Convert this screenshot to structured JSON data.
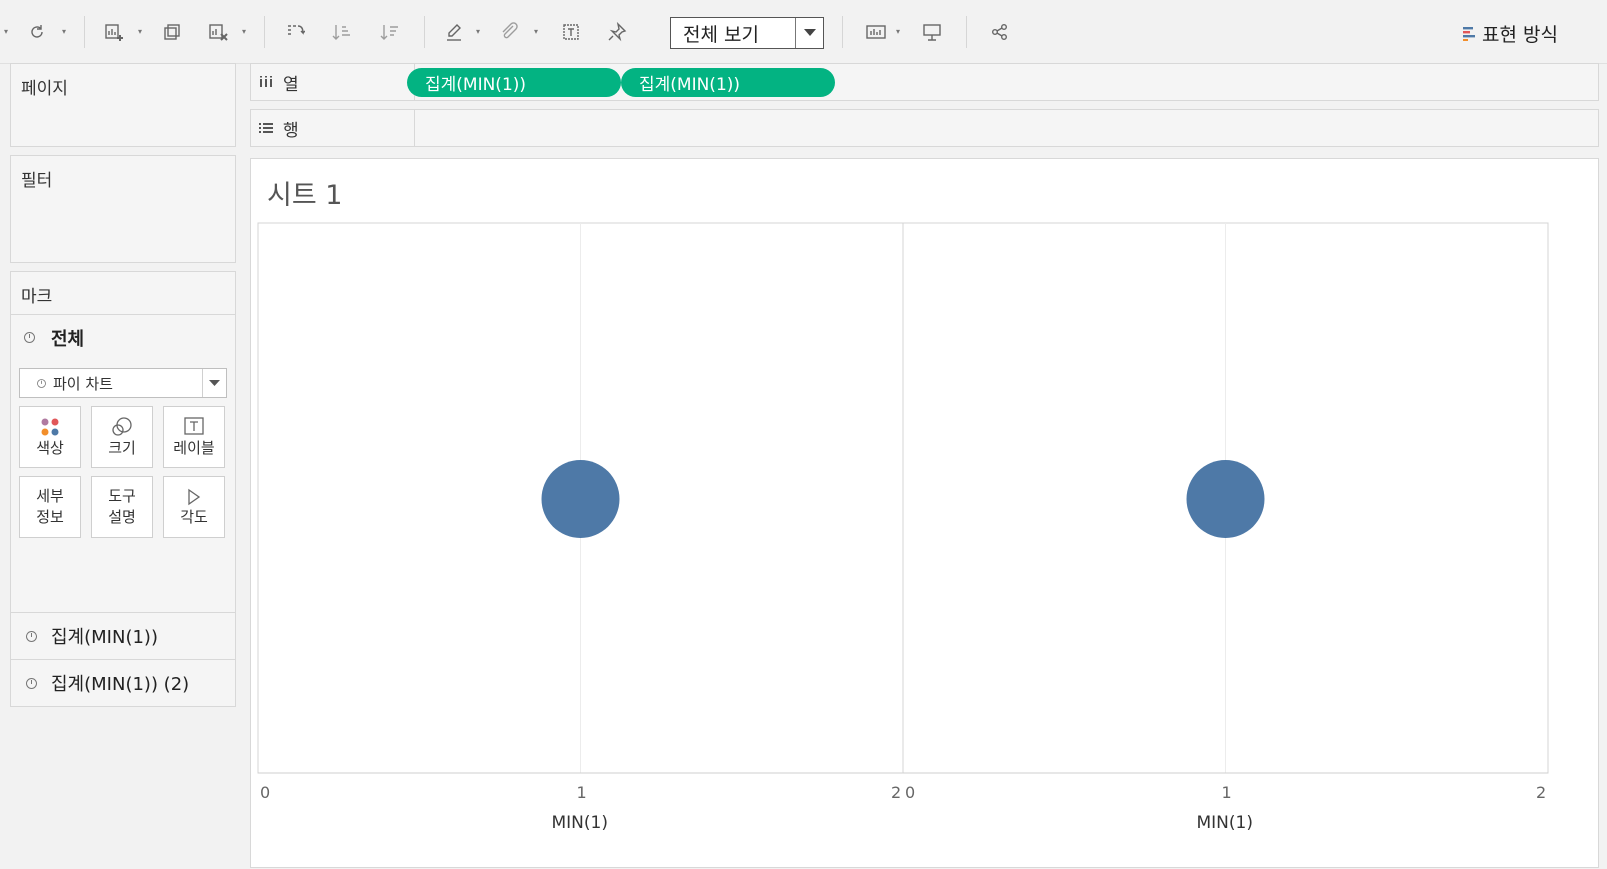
{
  "toolbar": {
    "view_select": "전체 보기",
    "show_me": "표현 방식"
  },
  "pages_panel": {
    "title": "페이지"
  },
  "filters_panel": {
    "title": "필터"
  },
  "marks_panel": {
    "title": "마크",
    "all_label": "전체",
    "mark_type": "파이 차트",
    "buttons": {
      "color": "색상",
      "size": "크기",
      "label": "레이블",
      "detail_1": "세부",
      "detail_2": "정보",
      "tooltip_1": "도구",
      "tooltip_2": "설명",
      "angle": "각도"
    },
    "cards": [
      "집계(MIN(1))",
      "집계(MIN(1)) (2)"
    ]
  },
  "shelves": {
    "columns_label": "열",
    "rows_label": "행",
    "column_pills": [
      "집계(MIN(1))",
      "집계(MIN(1))"
    ]
  },
  "sheet": {
    "title": "시트 1"
  },
  "chart_data": [
    {
      "type": "pie",
      "x_values": [
        1
      ],
      "xlim": [
        0,
        2
      ],
      "tick_labels": [
        "0",
        "1",
        "2"
      ],
      "xlabel": "MIN(1)",
      "color": "#4e79a7"
    },
    {
      "type": "pie",
      "x_values": [
        1
      ],
      "xlim": [
        0,
        2
      ],
      "tick_labels": [
        "0",
        "1",
        "2"
      ],
      "xlabel": "MIN(1)",
      "color": "#4e79a7"
    }
  ]
}
